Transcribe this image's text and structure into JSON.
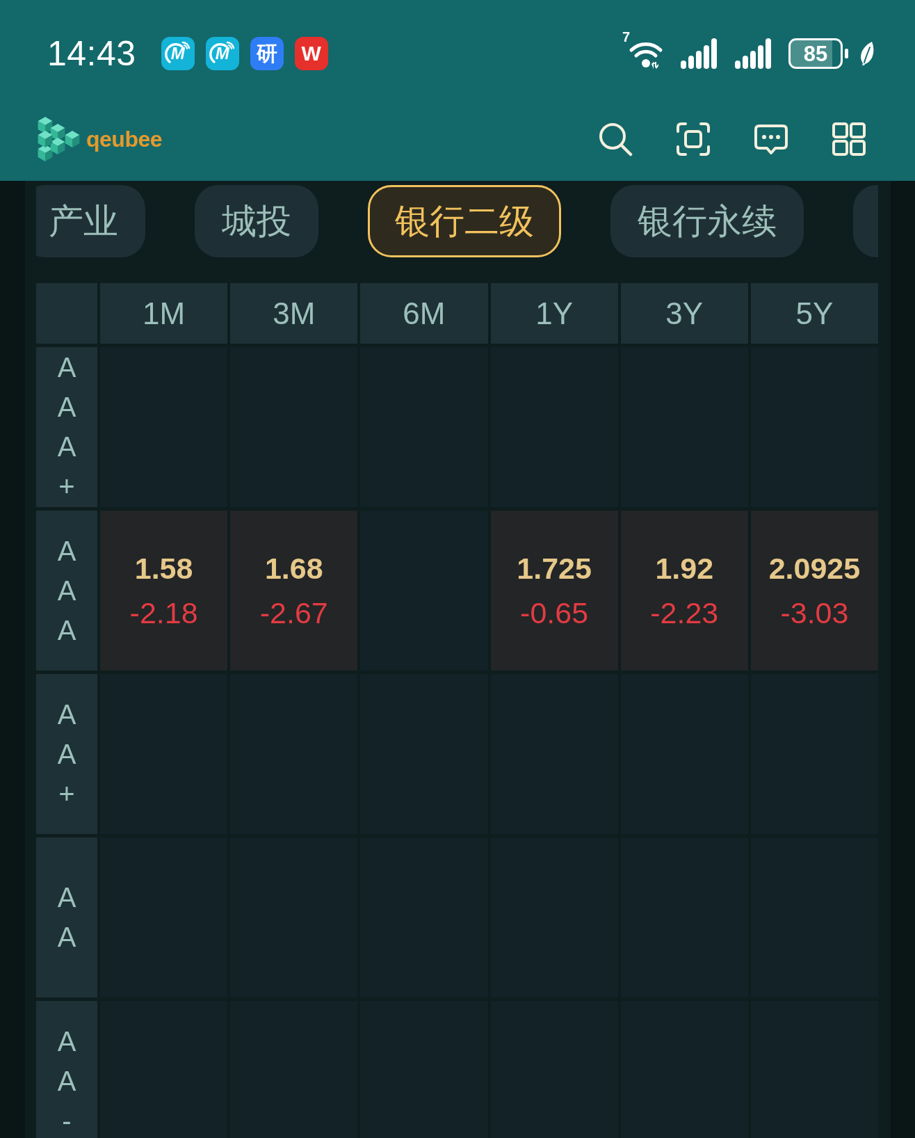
{
  "status_bar": {
    "time": "14:43",
    "notification_icons": [
      {
        "kind": "swoosh",
        "label": "M",
        "color": "#14b4d8"
      },
      {
        "kind": "swoosh",
        "label": "M",
        "color": "#14b4d8"
      },
      {
        "kind": "plain",
        "label": "研",
        "color": "#2f7df5"
      },
      {
        "kind": "plain",
        "label": "W",
        "color": "#e6302b"
      }
    ],
    "wifi_label": "7",
    "battery_percent": "85"
  },
  "app_bar": {
    "brand": "qeubee"
  },
  "tabs": [
    {
      "label": "产业",
      "selected": false
    },
    {
      "label": "城投",
      "selected": false
    },
    {
      "label": "银行二级",
      "selected": true
    },
    {
      "label": "银行永续",
      "selected": false
    },
    {
      "selected": false
    }
  ],
  "table": {
    "columns": [
      "1M",
      "3M",
      "6M",
      "1Y",
      "3Y",
      "5Y"
    ],
    "rows": [
      {
        "rating": "AAA+",
        "cells": [
          null,
          null,
          null,
          null,
          null,
          null
        ]
      },
      {
        "rating": "AAA",
        "cells": [
          {
            "value": "1.58",
            "change": "-2.18"
          },
          {
            "value": "1.68",
            "change": "-2.67"
          },
          null,
          {
            "value": "1.725",
            "change": "-0.65"
          },
          {
            "value": "1.92",
            "change": "-2.23"
          },
          {
            "value": "2.0925",
            "change": "-3.03"
          }
        ]
      },
      {
        "rating": "AA+",
        "cells": [
          null,
          null,
          null,
          null,
          null,
          null
        ]
      },
      {
        "rating": "AA",
        "cells": [
          null,
          null,
          null,
          null,
          null,
          null
        ]
      },
      {
        "rating": "AA-",
        "cells": [
          null,
          null,
          null,
          null,
          null,
          null
        ]
      }
    ]
  }
}
